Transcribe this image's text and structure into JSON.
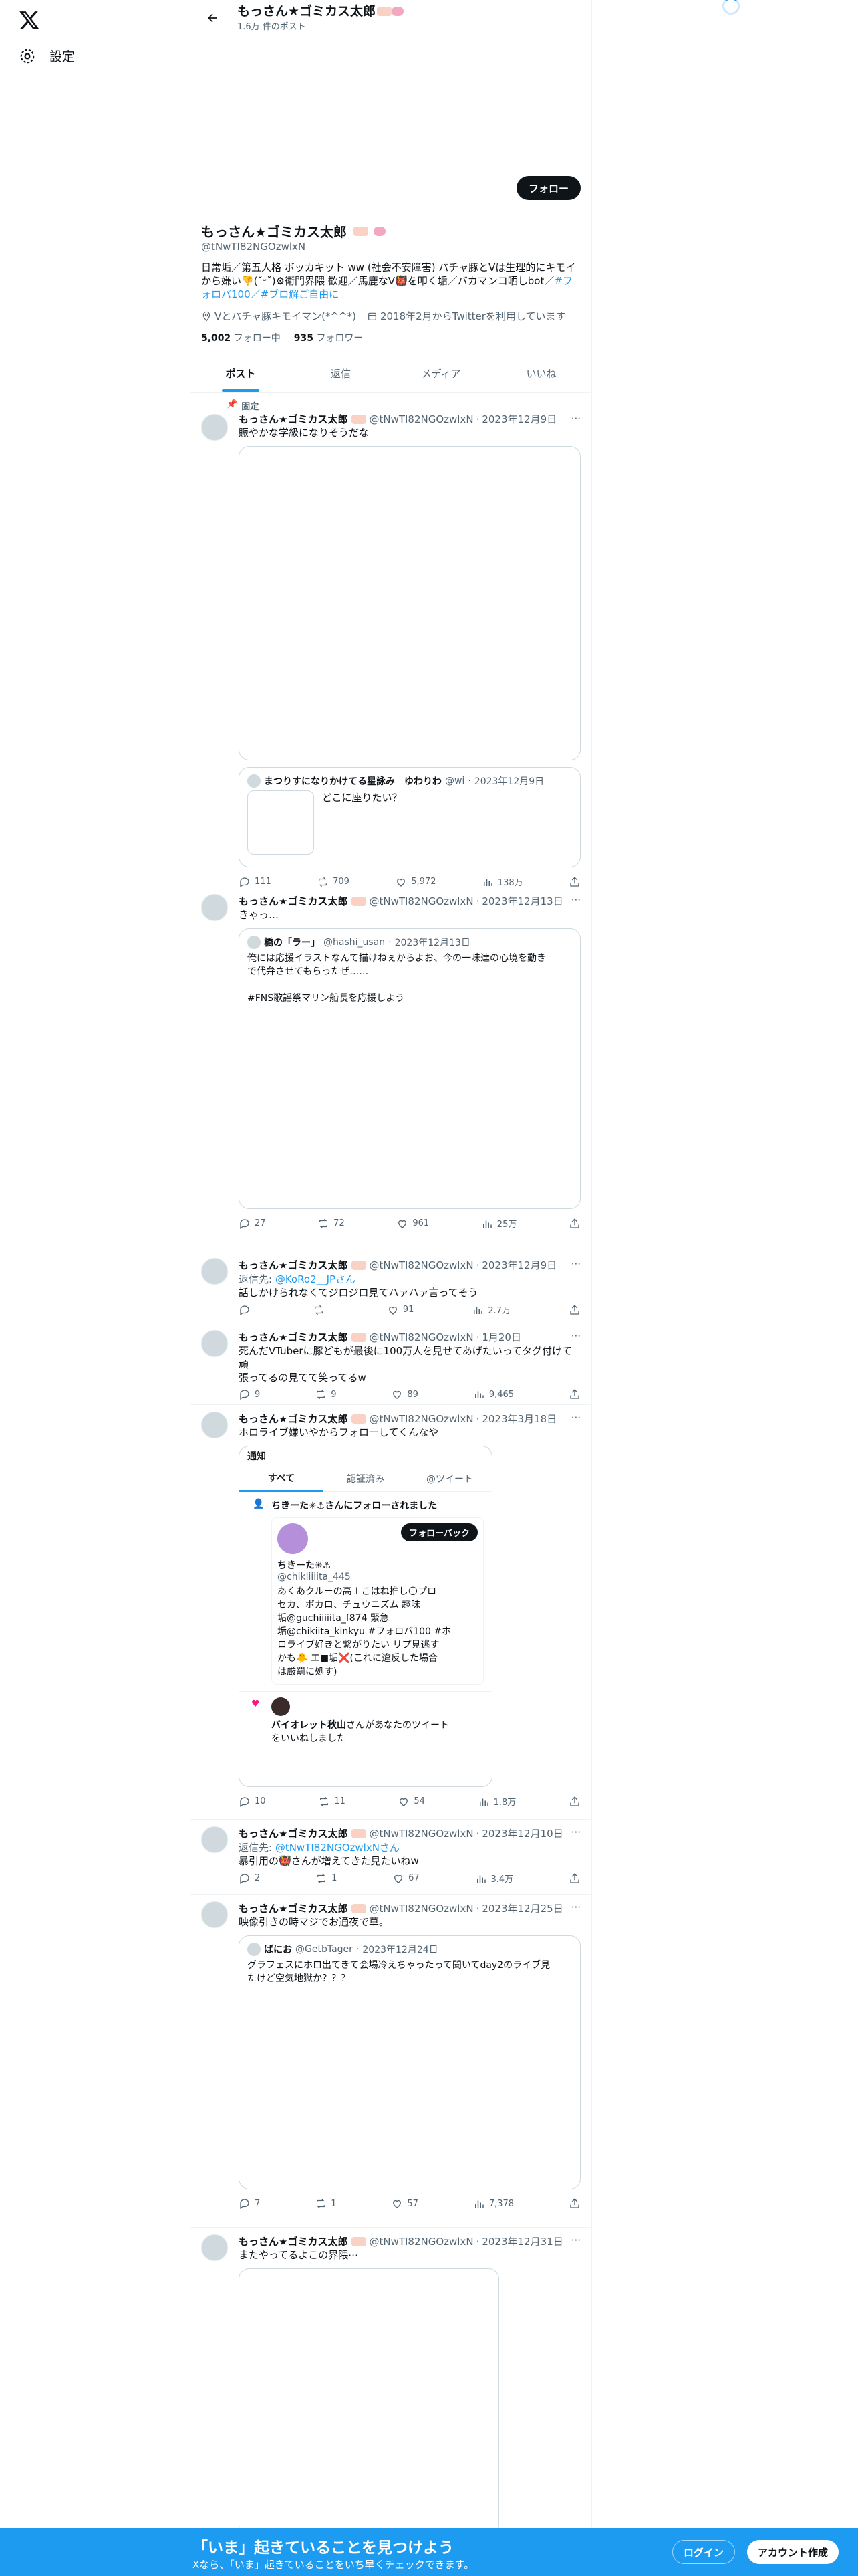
{
  "nav": {
    "settings_label": "設定"
  },
  "header": {
    "name": "もっさん★ゴミカス太郎",
    "post_count": "1.6万 件のポスト"
  },
  "profile": {
    "follow_label": "フォロー",
    "name": "もっさん★ゴミカス太郎",
    "handle": "@tNwTI82NGOzwlxN",
    "bio_line1": "日常垢／第五人格 ボッカキット ww (社会不安障害) パチャ豚とVは生理的にキモイ",
    "bio_line2": "から嫌い👎(˘ᵕ˘)⚙衛門界隈 歓迎／馬鹿なV👹を叩く垢／バカマンコ晒しbot／",
    "bio_link": "#フォロバ100／#ブロ解ご自由に",
    "location": "Vとパチャ豚キモイマン(*^^*)",
    "joined": "2018年2月からTwitterを利用しています",
    "following_count": "5,002",
    "following_label": "フォロー中",
    "followers_count": "935",
    "followers_label": "フォロワー"
  },
  "tabs": [
    {
      "label": "ポスト"
    },
    {
      "label": "返信"
    },
    {
      "label": "メディア"
    },
    {
      "label": "いいね"
    }
  ],
  "posts": [
    {
      "pinned_label": "固定",
      "name": "もっさん★ゴミカス太郎",
      "handle": "@tNwTI82NGOzwlxN",
      "date": "2023年12月9日",
      "text": "賑やかな学級になりそうだな",
      "quote_name": "まつりすになりかけてる星詠み　ゆわりわ",
      "quote_handle": "@wi",
      "quote_date": "2023年12月9日",
      "quote_text": "どこに座りたい？",
      "replies": "111",
      "reposts": "709",
      "likes": "5,972",
      "views": "138万"
    },
    {
      "name": "もっさん★ゴミカス太郎",
      "handle": "@tNwTI82NGOzwlxN",
      "date": "2023年12月13日",
      "text": "きゃっ…",
      "quote_name": "橋の「ラー」",
      "quote_handle": "@hashi_usan",
      "quote_date": "2023年12月13日",
      "quote_text": "俺には応援イラストなんて描けねぇからよお、今の一味達の心境を動き\nで代弁させてもらったぜ……\n\n#FNS歌謡祭マリン船長を応援しよう",
      "replies": "27",
      "reposts": "72",
      "likes": "961",
      "views": "25万"
    },
    {
      "name": "もっさん★ゴミカス太郎",
      "handle": "@tNwTI82NGOzwlxN",
      "date": "2023年12月9日",
      "reply_prefix": "返信先: ",
      "reply_to": "@KoRo2__JPさん",
      "text": "話しかけられなくてジロジロ見てハァハァ言ってそう",
      "replies": "",
      "reposts": "",
      "likes": "91",
      "views": "2.7万"
    },
    {
      "name": "もっさん★ゴミカス太郎",
      "handle": "@tNwTI82NGOzwlxN",
      "date": "1月20日",
      "text": "死んだVTuberに豚どもが最後に100万人を見せてあげたいってタグ付けて頑\n張ってるの見てて笑ってるw",
      "replies": "9",
      "reposts": "9",
      "likes": "89",
      "views": "9,465"
    },
    {
      "name": "もっさん★ゴミカス太郎",
      "handle": "@tNwTI82NGOzwlxN",
      "date": "2023年3月18日",
      "text": "ホロライブ嫌いやからフォローしてくんなや",
      "ss_title": "通知",
      "ss_tab1": "すべて",
      "ss_tab2": "認証済み",
      "ss_tab3": "@ツイート",
      "ss_notice": "ちきーた✳︎⚓さんにフォローされました",
      "ss_followback": "フォローバック",
      "ss_user": "ちきーた✳︎⚓",
      "ss_handle": "@chikiiiiita_445",
      "ss_bio": "あくあクルーの高１こはね推し🌕プロ\nセカ、ボカロ、チュウニズム 趣味\n垢@guchiiiiita_f874 緊急\n垢@chikiita_kinkyu #フォロバ100 #ホ\nロライブ好きと繋がりたい リプ見逃す\nかも🐥 エ■垢❌(これに違反した場合\nは厳罰に処す)",
      "ss_like_name": "バイオレット秋山",
      "ss_like_text": "さんがあなたのツイート\nをいいねしました",
      "replies": "10",
      "reposts": "11",
      "likes": "54",
      "views": "1.8万"
    },
    {
      "name": "もっさん★ゴミカス太郎",
      "handle": "@tNwTI82NGOzwlxN",
      "date": "2023年12月10日",
      "reply_prefix": "返信先: ",
      "reply_to": "@tNwTI82NGOzwlxNさん",
      "text": "暴引用の👹さんが増えてきた見たいねw",
      "replies": "2",
      "reposts": "1",
      "likes": "67",
      "views": "3.4万"
    },
    {
      "name": "もっさん★ゴミカス太郎",
      "handle": "@tNwTI82NGOzwlxN",
      "date": "2023年12月25日",
      "text": "映像引きの時マジでお通夜で草。",
      "quote_name": "ばにお",
      "quote_handle": "@GetbTager",
      "quote_date": "2023年12月24日",
      "quote_text": "グラフェスにホロ出てきて会場冷えちゃったって聞いてday2のライブ見\nたけど空気地獄か？？？",
      "replies": "7",
      "reposts": "1",
      "likes": "57",
      "views": "7,378"
    },
    {
      "name": "もっさん★ゴミカス太郎",
      "handle": "@tNwTI82NGOzwlxN",
      "date": "2023年12月31日",
      "text": "またやってるよこの界隈⋯"
    }
  ],
  "bottom": {
    "title": "「いま」起きていることを見つけよう",
    "subtitle": "Xなら、「いま」起きていることをいち早くチェックできます。",
    "login": "ログイン",
    "signup": "アカウント作成"
  }
}
